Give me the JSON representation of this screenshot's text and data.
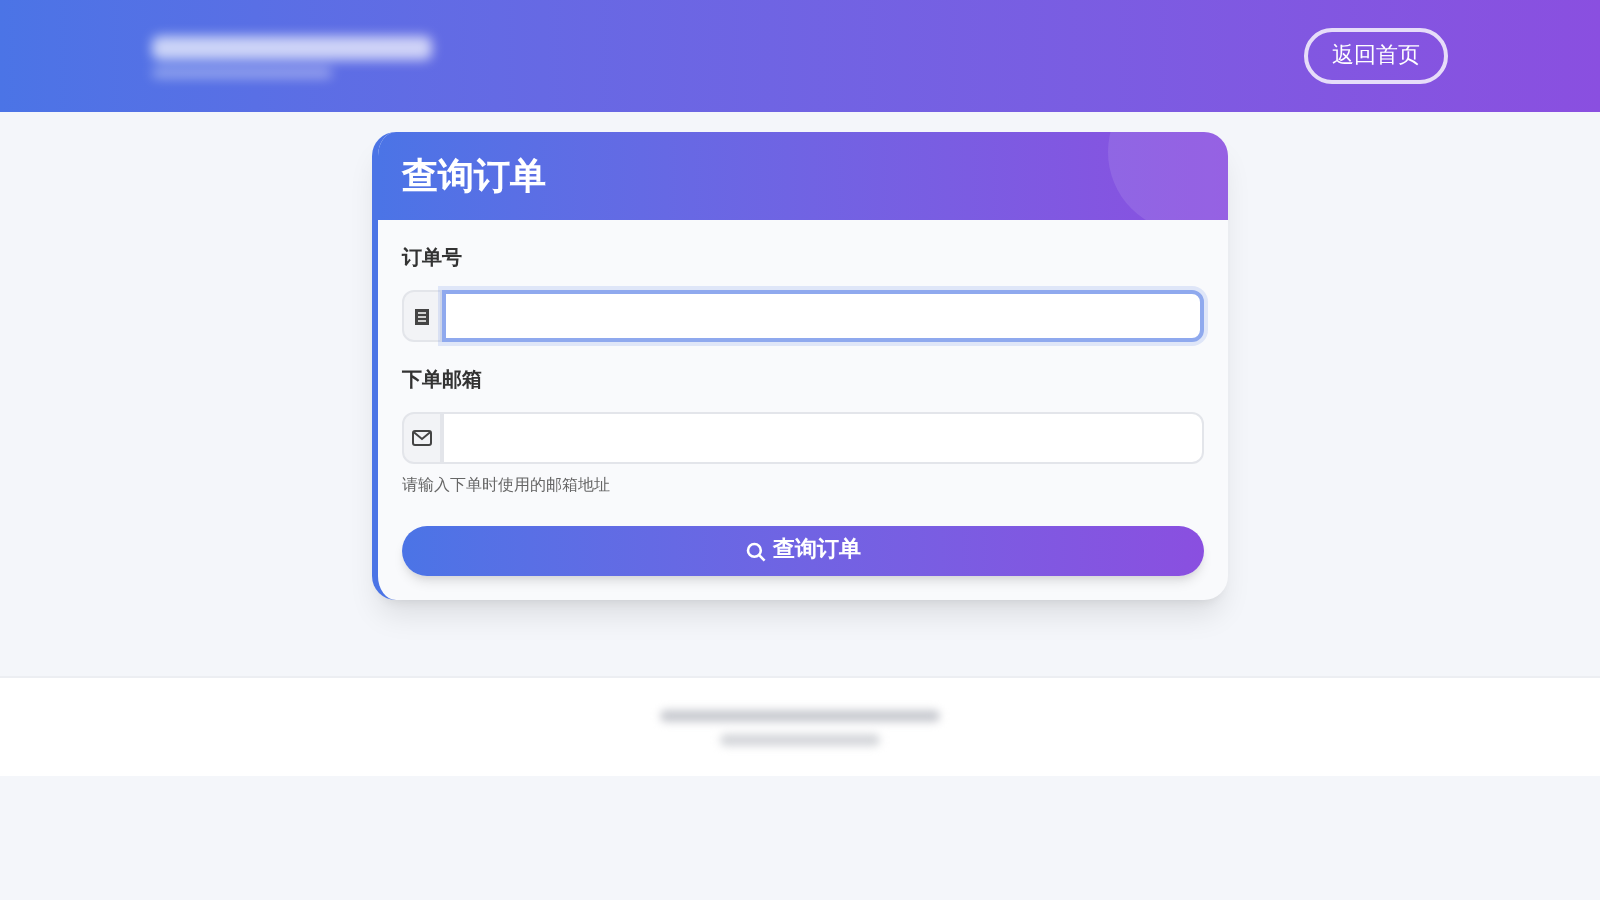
{
  "header": {
    "home_button": "返回首页"
  },
  "card": {
    "title": "查询订单",
    "fields": [
      {
        "label": "订单号",
        "kind": "number",
        "focused": true
      },
      {
        "label": "下单邮箱",
        "kind": "email",
        "focused": false,
        "hint": "请输入下单时使用的邮箱地址"
      }
    ],
    "submit": "查询订单"
  }
}
